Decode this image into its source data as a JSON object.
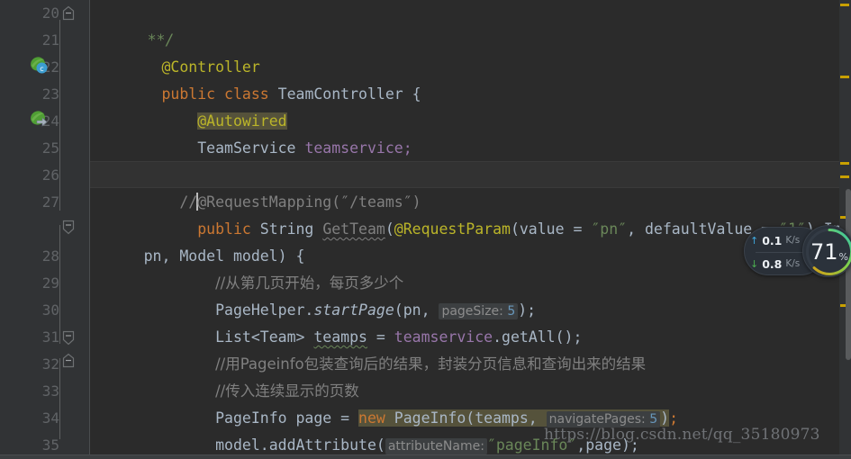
{
  "editor": {
    "app": "IntelliJ IDEA Java Editor",
    "theme_bg": "#2b2b2b",
    "gutter_bg": "#313335",
    "accent_marker": "#c8a000",
    "lines": [
      {
        "num": "20"
      },
      {
        "num": "21"
      },
      {
        "num": "22"
      },
      {
        "num": "23"
      },
      {
        "num": "24"
      },
      {
        "num": "25"
      },
      {
        "num": "26"
      },
      {
        "num": "27"
      },
      {
        "num": "28"
      },
      {
        "num": "29"
      },
      {
        "num": "30"
      },
      {
        "num": "31"
      },
      {
        "num": "32"
      },
      {
        "num": "33"
      },
      {
        "num": "34"
      },
      {
        "num": "35"
      }
    ],
    "code": {
      "l20_comment_end": "**/",
      "l21_annotation": "@Controller",
      "l22_public": "public",
      "l22_class": "class",
      "l22_name": "TeamController",
      "l22_brace": "{",
      "l23_autowired": "@Autowired",
      "l24_type": "TeamService",
      "l24_field": "teamservice",
      "l24_semi": ";",
      "l26_slashes": "//",
      "l26_rest": "@RequestMapping(″/teams″)",
      "l27_public": "public",
      "l27_string": "String",
      "l27_method": "GetTeam",
      "l27_paren": "(",
      "l27_anno": "@RequestParam",
      "l27_open": "(",
      "l27_value": "value",
      "l27_eq1": " = ",
      "l27_pn": "″pn″",
      "l27_comma": ", ",
      "l27_defaultValue": "defaultValue",
      "l27_eq2": " = ",
      "l27_one": "″1″",
      "l27_close": ")",
      "l27_integer": " Integer",
      "l27b_pn": "pn, Model model) {",
      "l28_comment": "//从第几页开始，每页多少个",
      "l29_class": "PageHelper.",
      "l29_method": "startPage",
      "l29_args_open": "(pn, ",
      "l29_hint": "pageSize:",
      "l29_hint_val": "5",
      "l29_tail": ");",
      "l30_list": "List<Team> ",
      "l30_var": "teamps",
      "l30_eq": " = ",
      "l30_service": "teamservice",
      "l30_call": ".getAll();",
      "l31_comment": "//用Pageinfo包装查询后的结果，封装分页信息和查询出来的结果",
      "l32_comment": "//传入连续显示的页数",
      "l33_decl": "PageInfo page = ",
      "l33_new": "new",
      "l33_ctor": " PageInfo(teamps, ",
      "l33_hint": "navigatePages:",
      "l33_hint_val": "5",
      "l33_close": ")",
      "l33_semi": ";",
      "l34_model": "model.addAttribute(",
      "l34_hint": "attributeName:",
      "l34_str": "″pageInfo″",
      "l34_tail": ",page);"
    },
    "gutter_icons": [
      {
        "name": "spring-bean-class-icon",
        "line": "22"
      },
      {
        "name": "spring-autowired-icon",
        "line": "24"
      }
    ],
    "fold_markers": [
      {
        "line": "20",
        "type": "fold-end-top"
      },
      {
        "line": "27",
        "type": "fold-collapse"
      },
      {
        "line": "31",
        "type": "fold-collapse"
      },
      {
        "line": "32",
        "type": "fold-collapse"
      }
    ]
  },
  "network_widget": {
    "upload_value": "0.1",
    "upload_unit": "K/s",
    "download_value": "0.8",
    "download_unit": "K/s",
    "upload_arrow": "↑",
    "download_arrow": "↓",
    "upload_color": "#3fa9e0",
    "download_color": "#4caf50"
  },
  "gauge": {
    "value": "71",
    "unit": "%",
    "percent": 71,
    "ring_colors": [
      "#2ec4b6",
      "#8bc34a",
      "#d4a017"
    ]
  },
  "watermark": {
    "text": "https://blog.csdn.net/qq_35180973"
  }
}
